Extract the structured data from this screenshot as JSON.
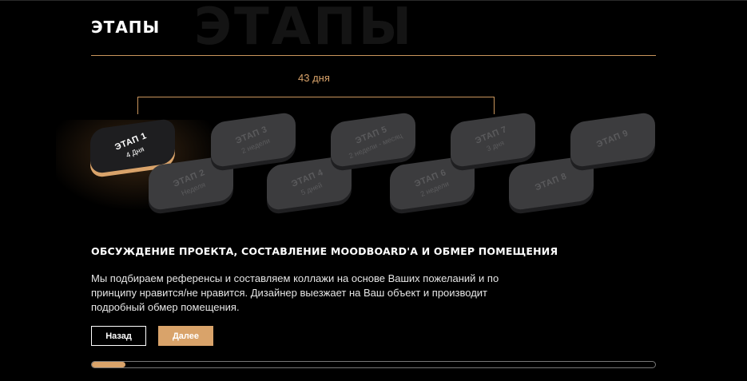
{
  "section": {
    "title": "ЭТАПЫ",
    "bg_title": "ЭТАПЫ"
  },
  "timeline": {
    "duration": "43 дня",
    "active_index": 0,
    "stages": [
      {
        "label": "ЭТАП 1",
        "duration": "4 Дня"
      },
      {
        "label": "ЭТАП 2",
        "duration": "Неделя"
      },
      {
        "label": "ЭТАП 3",
        "duration": "2 недели"
      },
      {
        "label": "ЭТАП 4",
        "duration": "5 дней"
      },
      {
        "label": "ЭТАП 5",
        "duration": "2 недели - месяц"
      },
      {
        "label": "ЭТАП 6",
        "duration": "2 недели"
      },
      {
        "label": "ЭТАП 7",
        "duration": "3 дня"
      },
      {
        "label": "ЭТАП 8",
        "duration": ""
      },
      {
        "label": "ЭТАП 9",
        "duration": ""
      }
    ]
  },
  "content": {
    "heading": "ОБСУЖДЕНИЕ ПРОЕКТА, СОСТАВЛЕНИЕ MOODBOARD'A И ОБМЕР ПОМЕЩЕНИЯ",
    "description": "Мы подбираем референсы и составляем коллажи на основе Ваших пожеланий и по принципу нравится/не нравится. Дизайнер выезжает на Ваш объект и производит подробный обмер помещения."
  },
  "buttons": {
    "back_label": "Назад",
    "next_label": "Далее"
  },
  "progress": {
    "value": 0.06
  },
  "colors": {
    "accent": "#d9a36a",
    "background": "#000000",
    "card_inactive": "#3c3c3e"
  }
}
